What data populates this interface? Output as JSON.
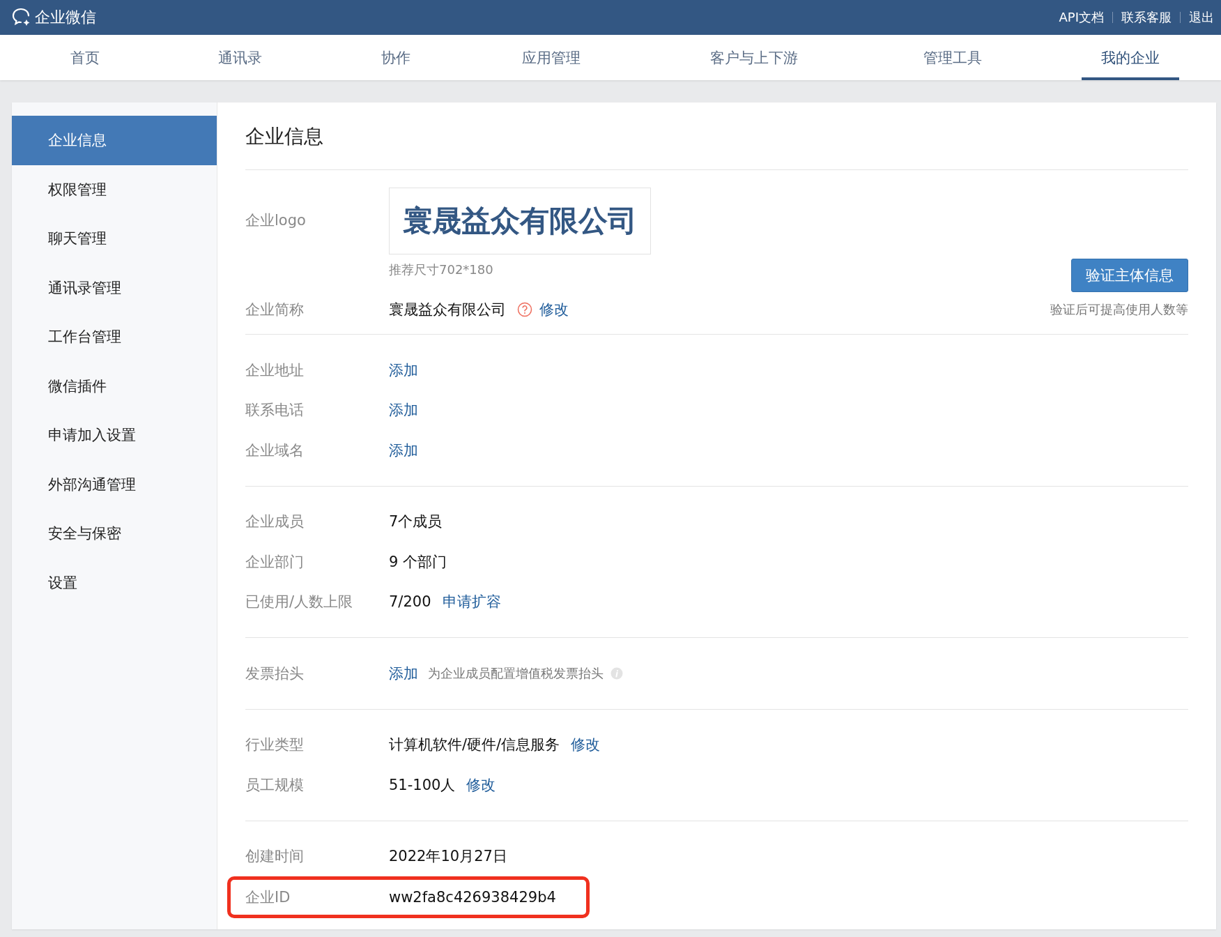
{
  "header": {
    "brand": "企业微信",
    "links": [
      "API文档",
      "联系客服",
      "退出"
    ]
  },
  "nav": [
    {
      "label": "首页",
      "selected": false
    },
    {
      "label": "通讯录",
      "selected": false
    },
    {
      "label": "协作",
      "selected": false
    },
    {
      "label": "应用管理",
      "selected": false
    },
    {
      "label": "客户与上下游",
      "selected": false
    },
    {
      "label": "管理工具",
      "selected": false
    },
    {
      "label": "我的企业",
      "selected": true
    }
  ],
  "sidebar": {
    "items": [
      {
        "label": "企业信息",
        "selected": true
      },
      {
        "label": "权限管理",
        "selected": false
      },
      {
        "label": "聊天管理",
        "selected": false
      },
      {
        "label": "通讯录管理",
        "selected": false
      },
      {
        "label": "工作台管理",
        "selected": false
      },
      {
        "label": "微信插件",
        "selected": false
      },
      {
        "label": "申请加入设置",
        "selected": false
      },
      {
        "label": "外部沟通管理",
        "selected": false
      },
      {
        "label": "安全与保密",
        "selected": false
      },
      {
        "label": "设置",
        "selected": false
      }
    ]
  },
  "page_title": "企业信息",
  "logo_row": {
    "label": "企业logo",
    "logo_text": "寰晟益众有限公司",
    "hint": "推荐尺寸702*180"
  },
  "verify": {
    "button": "验证主体信息",
    "note": "验证后可提高使用人数等"
  },
  "sections": [
    [
      {
        "label": "企业简称",
        "highlighted": false,
        "parts": [
          {
            "kind": "text",
            "text": "寰晟益众有限公司"
          },
          {
            "kind": "help"
          },
          {
            "kind": "link",
            "text": "修改"
          }
        ]
      }
    ],
    [
      {
        "label": "企业地址",
        "highlighted": false,
        "parts": [
          {
            "kind": "link",
            "text": "添加"
          }
        ]
      },
      {
        "label": "联系电话",
        "highlighted": false,
        "parts": [
          {
            "kind": "link",
            "text": "添加"
          }
        ]
      },
      {
        "label": "企业域名",
        "highlighted": false,
        "parts": [
          {
            "kind": "link",
            "text": "添加"
          }
        ]
      }
    ],
    [
      {
        "label": "企业成员",
        "highlighted": false,
        "parts": [
          {
            "kind": "text",
            "text": "7个成员"
          }
        ]
      },
      {
        "label": "企业部门",
        "highlighted": false,
        "parts": [
          {
            "kind": "text",
            "text": "9 个部门"
          }
        ]
      },
      {
        "label": "已使用/人数上限",
        "highlighted": false,
        "parts": [
          {
            "kind": "text",
            "text": "7/200"
          },
          {
            "kind": "link",
            "text": "申请扩容"
          }
        ]
      }
    ],
    [
      {
        "label": "发票抬头",
        "highlighted": false,
        "parts": [
          {
            "kind": "link",
            "text": "添加"
          },
          {
            "kind": "hint",
            "text": "为企业成员配置增值税发票抬头"
          },
          {
            "kind": "info"
          }
        ]
      }
    ],
    [
      {
        "label": "行业类型",
        "highlighted": false,
        "parts": [
          {
            "kind": "text",
            "text": "计算机软件/硬件/信息服务"
          },
          {
            "kind": "link",
            "text": "修改"
          }
        ]
      },
      {
        "label": "员工规模",
        "highlighted": false,
        "parts": [
          {
            "kind": "text",
            "text": "51-100人"
          },
          {
            "kind": "link",
            "text": "修改"
          }
        ]
      }
    ],
    [
      {
        "label": "创建时间",
        "highlighted": false,
        "parts": [
          {
            "kind": "text",
            "text": "2022年10月27日"
          }
        ]
      },
      {
        "label": "企业ID",
        "highlighted": true,
        "parts": [
          {
            "kind": "text",
            "text": "ww2fa8c426938429b4"
          }
        ]
      }
    ]
  ]
}
